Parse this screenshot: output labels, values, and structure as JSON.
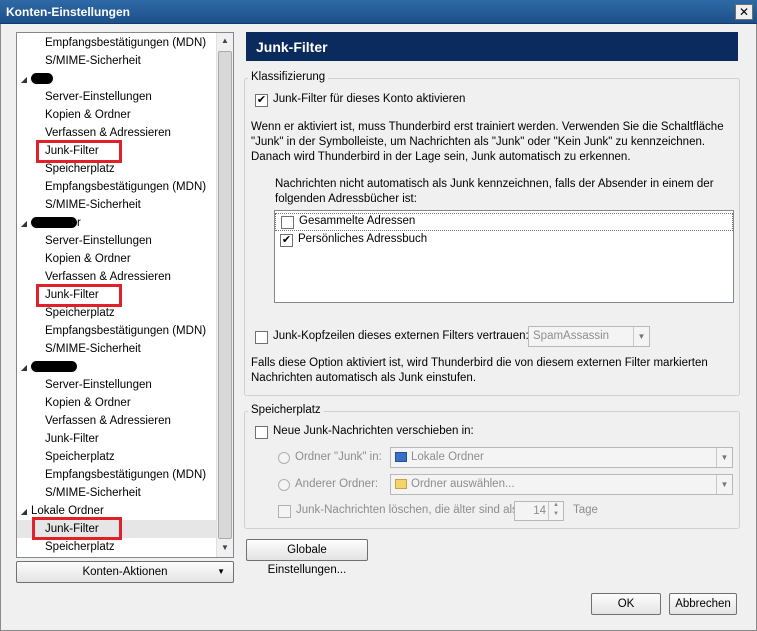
{
  "window": {
    "title": "Konten-Einstellungen",
    "close_glyph": "✕"
  },
  "tree": {
    "items": [
      {
        "label": "Empfangsbestätigungen (MDN)",
        "level": "sub"
      },
      {
        "label": "S/MIME-Sicherheit",
        "level": "sub"
      },
      {
        "label": "",
        "level": "account",
        "redacted": true
      },
      {
        "label": "Server-Einstellungen",
        "level": "sub"
      },
      {
        "label": "Kopien & Ordner",
        "level": "sub"
      },
      {
        "label": "Verfassen & Adressieren",
        "level": "sub"
      },
      {
        "label": "Junk-Filter",
        "level": "sub",
        "highlight": true
      },
      {
        "label": "Speicherplatz",
        "level": "sub"
      },
      {
        "label": "Empfangsbestätigungen (MDN)",
        "level": "sub"
      },
      {
        "label": "S/MIME-Sicherheit",
        "level": "sub"
      },
      {
        "label": "r",
        "level": "account",
        "redacted": true
      },
      {
        "label": "Server-Einstellungen",
        "level": "sub"
      },
      {
        "label": "Kopien & Ordner",
        "level": "sub"
      },
      {
        "label": "Verfassen & Adressieren",
        "level": "sub"
      },
      {
        "label": "Junk-Filter",
        "level": "sub",
        "highlight": true
      },
      {
        "label": "Speicherplatz",
        "level": "sub"
      },
      {
        "label": "Empfangsbestätigungen (MDN)",
        "level": "sub"
      },
      {
        "label": "S/MIME-Sicherheit",
        "level": "sub"
      },
      {
        "label": "",
        "level": "account",
        "redacted": true
      },
      {
        "label": "Server-Einstellungen",
        "level": "sub"
      },
      {
        "label": "Kopien & Ordner",
        "level": "sub"
      },
      {
        "label": "Verfassen & Adressieren",
        "level": "sub"
      },
      {
        "label": "Junk-Filter",
        "level": "sub"
      },
      {
        "label": "Speicherplatz",
        "level": "sub"
      },
      {
        "label": "Empfangsbestätigungen (MDN)",
        "level": "sub"
      },
      {
        "label": "S/MIME-Sicherheit",
        "level": "sub"
      },
      {
        "label": "Lokale Ordner",
        "level": "account"
      },
      {
        "label": "Junk-Filter",
        "level": "sub",
        "highlight": true,
        "selected": true
      },
      {
        "label": "Speicherplatz",
        "level": "sub"
      }
    ]
  },
  "account_actions": {
    "label": "Konten-Aktionen"
  },
  "panel": {
    "title": "Junk-Filter"
  },
  "classification": {
    "legend": "Klassifizierung",
    "enable_label": "Junk-Filter für dieses Konto aktivieren",
    "enable_checked": true,
    "description": "Wenn er aktiviert ist, muss Thunderbird erst trainiert werden. Verwenden Sie die Schaltfläche \"Junk\" in der Symbolleiste, um Nachrichten als \"Junk\" oder \"Kein Junk\" zu kennzeichnen. Danach wird Thunderbird in der Lage sein, Junk automatisch zu erkennen.",
    "whitelist_label": "Nachrichten nicht automatisch als Junk kennzeichnen, falls der Absender in einem der folgenden Adressbücher ist:",
    "address_books": [
      {
        "label": "Gesammelte Adressen",
        "checked": false
      },
      {
        "label": "Persönliches Adressbuch",
        "checked": true
      }
    ],
    "trust_headers_label": "Junk-Kopfzeilen dieses externen Filters vertrauen:",
    "trust_headers_checked": false,
    "filter_select": "SpamAssassin",
    "trust_note": "Falls diese Option aktiviert ist, wird Thunderbird die von diesem externen Filter markierten Nachrichten automatisch als Junk einstufen."
  },
  "storage": {
    "legend": "Speicherplatz",
    "move_label": "Neue Junk-Nachrichten verschieben in:",
    "move_checked": false,
    "folder_junk_label": "Ordner \"Junk\" in:",
    "folder_junk_value": "Lokale Ordner",
    "other_folder_label": "Anderer Ordner:",
    "other_folder_value": "Ordner auswählen...",
    "delete_label": "Junk-Nachrichten löschen, die älter sind als",
    "delete_days": "14",
    "days_unit": "Tage"
  },
  "buttons": {
    "global_settings": "Globale Einstellungen...",
    "ok": "OK",
    "cancel": "Abbrechen"
  },
  "colors": {
    "header_bg": "#0b2a5e",
    "highlight_border": "#e2202a",
    "selected_bg": "#e6e6e6"
  }
}
